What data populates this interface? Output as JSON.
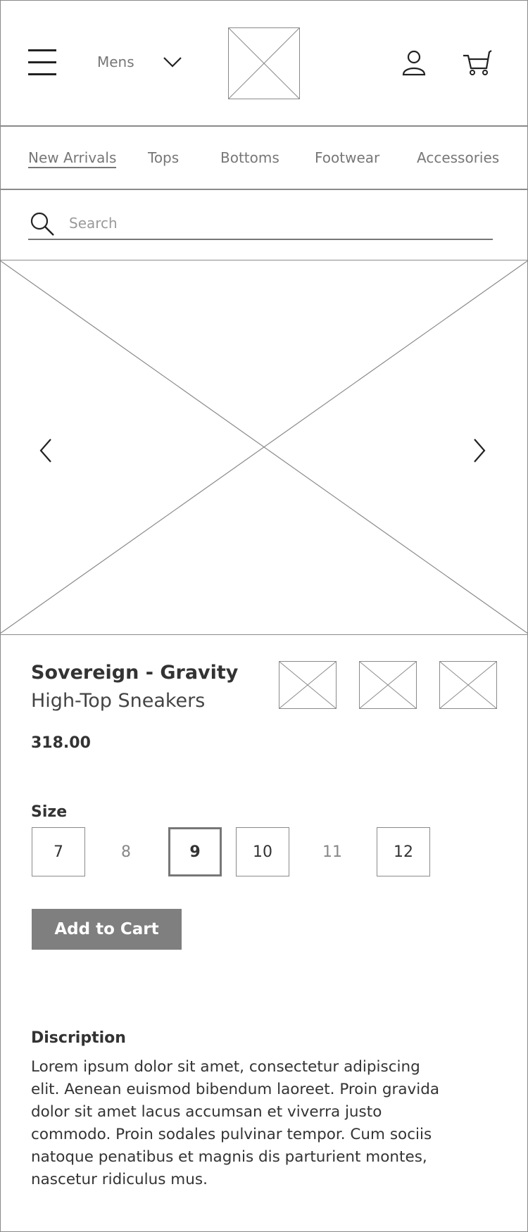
{
  "header": {
    "gender_label": "Mens",
    "logo": "image-placeholder"
  },
  "categories": [
    {
      "label": "New Arrivals",
      "active": true
    },
    {
      "label": "Tops",
      "active": false
    },
    {
      "label": "Bottoms",
      "active": false
    },
    {
      "label": "Footwear",
      "active": false
    },
    {
      "label": "Accessories",
      "active": false
    }
  ],
  "search": {
    "placeholder": "Search",
    "value": ""
  },
  "product": {
    "name": "Sovereign - Gravity",
    "subtitle": "High-Top Sneakers",
    "price": "318.00",
    "size_label": "Size",
    "sizes": [
      {
        "label": "7",
        "available": true,
        "selected": false
      },
      {
        "label": "8",
        "available": false,
        "selected": false
      },
      {
        "label": "9",
        "available": true,
        "selected": true
      },
      {
        "label": "10",
        "available": true,
        "selected": false
      },
      {
        "label": "11",
        "available": false,
        "selected": false
      },
      {
        "label": "12",
        "available": true,
        "selected": false
      }
    ],
    "add_to_cart_label": "Add to Cart",
    "description_title": "Discription",
    "description_text": "Lorem ipsum dolor sit amet, consectetur adipiscing elit. Aenean euismod bibendum laoreet. Proin gravida dolor sit amet lacus accumsan et viverra justo commodo. Proin sodales pulvinar tempor. Cum sociis natoque penatibus et magnis dis parturient montes, nascetur ridiculus mus."
  },
  "colors": {
    "border": "#8a8a8a",
    "button_bg": "#7f7f7f",
    "muted_text": "#777777",
    "text": "#333333"
  },
  "icons": {
    "menu": "hamburger-icon",
    "dropdown": "chevron-down-icon",
    "account": "user-icon",
    "cart": "cart-icon",
    "search": "search-icon",
    "prev": "chevron-left-icon",
    "next": "chevron-right-icon"
  }
}
